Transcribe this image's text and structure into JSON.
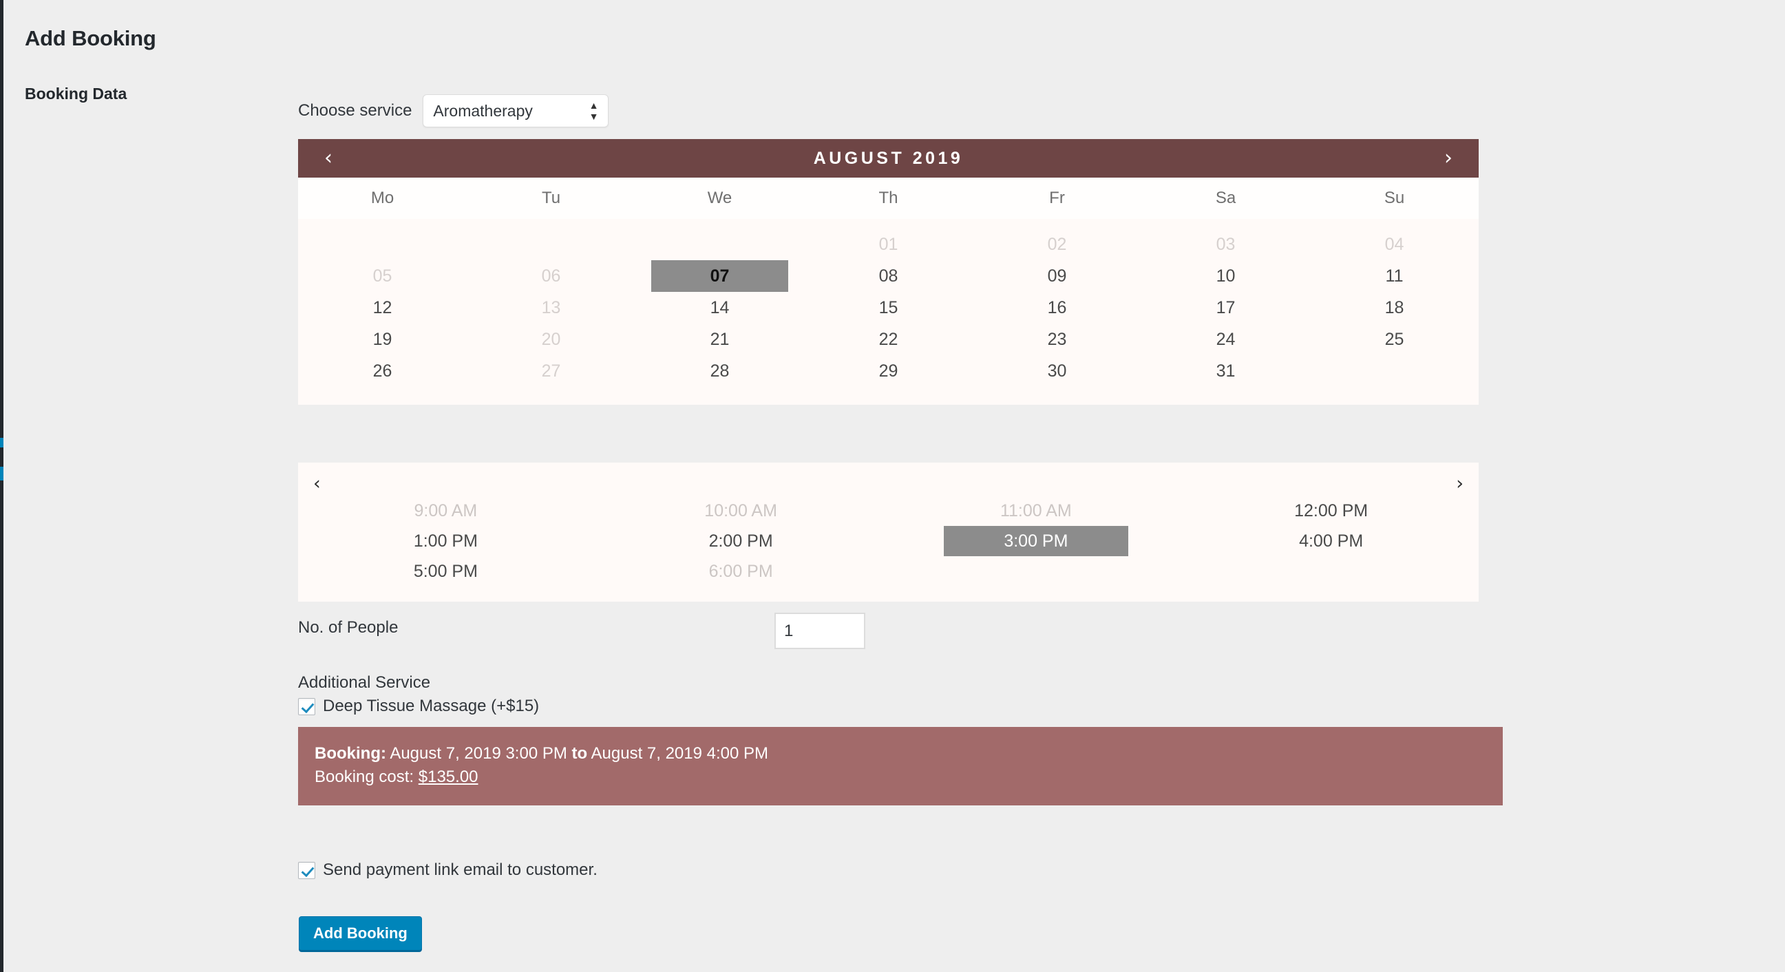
{
  "page": {
    "title": "Add Booking",
    "section_label": "Booking Data"
  },
  "service": {
    "label": "Choose service",
    "selected": "Aromatherapy",
    "up_arrow": "▲",
    "down_arrow": "▼"
  },
  "calendar": {
    "title": "AUGUST 2019",
    "prev_icon": "‹",
    "next_icon": "›",
    "weekdays": [
      "Mo",
      "Tu",
      "We",
      "Th",
      "Fr",
      "Sa",
      "Su"
    ],
    "weeks": [
      [
        {
          "label": "",
          "state": "empty"
        },
        {
          "label": "",
          "state": "empty"
        },
        {
          "label": "",
          "state": "empty"
        },
        {
          "label": "01",
          "state": "disabled"
        },
        {
          "label": "02",
          "state": "disabled"
        },
        {
          "label": "03",
          "state": "disabled"
        },
        {
          "label": "04",
          "state": "disabled"
        }
      ],
      [
        {
          "label": "05",
          "state": "disabled"
        },
        {
          "label": "06",
          "state": "disabled"
        },
        {
          "label": "07",
          "state": "selected"
        },
        {
          "label": "08",
          "state": "available"
        },
        {
          "label": "09",
          "state": "available"
        },
        {
          "label": "10",
          "state": "available"
        },
        {
          "label": "11",
          "state": "available"
        }
      ],
      [
        {
          "label": "12",
          "state": "available"
        },
        {
          "label": "13",
          "state": "disabled"
        },
        {
          "label": "14",
          "state": "available"
        },
        {
          "label": "15",
          "state": "available"
        },
        {
          "label": "16",
          "state": "available"
        },
        {
          "label": "17",
          "state": "available"
        },
        {
          "label": "18",
          "state": "available"
        }
      ],
      [
        {
          "label": "19",
          "state": "available"
        },
        {
          "label": "20",
          "state": "disabled"
        },
        {
          "label": "21",
          "state": "available"
        },
        {
          "label": "22",
          "state": "available"
        },
        {
          "label": "23",
          "state": "available"
        },
        {
          "label": "24",
          "state": "available"
        },
        {
          "label": "25",
          "state": "available"
        }
      ],
      [
        {
          "label": "26",
          "state": "available"
        },
        {
          "label": "27",
          "state": "disabled"
        },
        {
          "label": "28",
          "state": "available"
        },
        {
          "label": "29",
          "state": "available"
        },
        {
          "label": "30",
          "state": "available"
        },
        {
          "label": "31",
          "state": "available"
        },
        {
          "label": "",
          "state": "empty"
        }
      ]
    ]
  },
  "timeslots": {
    "prev_icon": "‹",
    "next_icon": "›",
    "rows": [
      [
        {
          "label": "9:00 AM",
          "state": "disabled"
        },
        {
          "label": "10:00 AM",
          "state": "disabled"
        },
        {
          "label": "11:00 AM",
          "state": "disabled"
        },
        {
          "label": "12:00 PM",
          "state": "available"
        }
      ],
      [
        {
          "label": "1:00 PM",
          "state": "available"
        },
        {
          "label": "2:00 PM",
          "state": "available"
        },
        {
          "label": "3:00 PM",
          "state": "selected"
        },
        {
          "label": "4:00 PM",
          "state": "available"
        }
      ],
      [
        {
          "label": "5:00 PM",
          "state": "available"
        },
        {
          "label": "6:00 PM",
          "state": "disabled"
        },
        {
          "label": "",
          "state": "empty"
        },
        {
          "label": "",
          "state": "empty"
        }
      ]
    ]
  },
  "people": {
    "label": "No. of People",
    "value": "1"
  },
  "additional_service": {
    "title": "Additional Service",
    "option_label": "Deep Tissue Massage (+$15)",
    "checked": true
  },
  "booking_summary": {
    "prefix": "Booking:",
    "start": "August 7, 2019 3:00 PM",
    "joiner": "to",
    "end": "August 7, 2019 4:00 PM",
    "cost_label": "Booking cost:",
    "cost_value": "$135.00"
  },
  "send_payment": {
    "label": "Send payment link email to customer.",
    "checked": true
  },
  "submit": {
    "label": "Add Booking"
  },
  "colors": {
    "page_background": "#eeeeee",
    "calendar_header": "#6e4545",
    "calendar_body": "#fffaf8",
    "calendar_weekday_row": "#fffefd",
    "selected_cell": "#8c8c8c",
    "summary_background": "#a26a6a",
    "primary_button": "#0085ba",
    "admin_rail": "#23282d",
    "admin_rail_accent": "#0085ba"
  }
}
